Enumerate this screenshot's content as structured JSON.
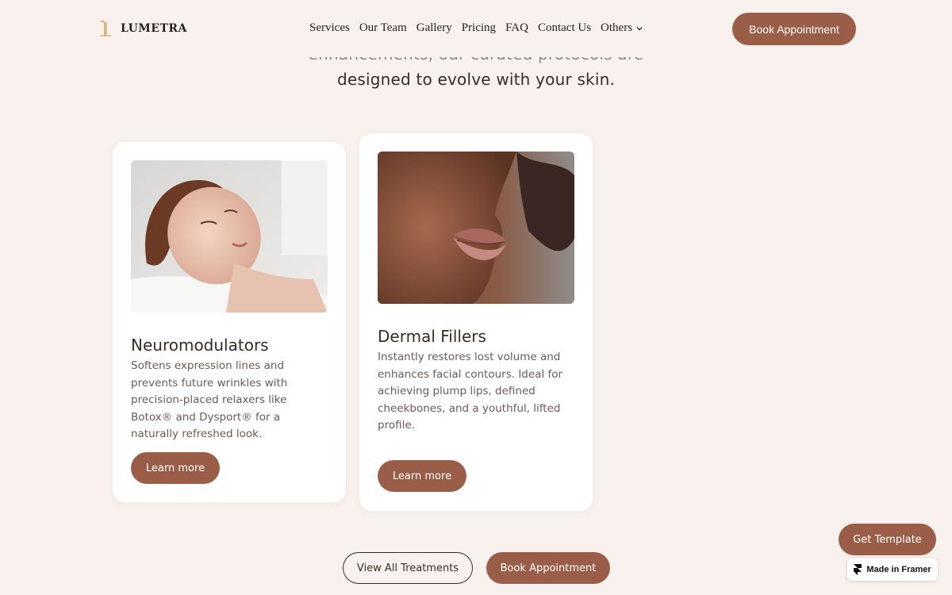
{
  "brand": {
    "name": "LUMETRA",
    "accent": "#9a5e48",
    "logo_color": "#d9b277"
  },
  "nav": {
    "items": [
      "Services",
      "Our Team",
      "Gallery",
      "Pricing",
      "FAQ",
      "Contact Us"
    ],
    "others_label": "Others"
  },
  "header": {
    "book_label": "Book Appointment"
  },
  "intro": {
    "line1": "enhancements, our curated protocols are",
    "line2": "designed to evolve with your skin."
  },
  "cards": [
    {
      "title": "Neuromodulators",
      "description": "Softens expression lines and prevents future wrinkles with precision-placed relaxers like Botox® and Dysport® for a naturally refreshed look.",
      "button": "Learn more",
      "image_icon": "woman-face-photo"
    },
    {
      "title": "Dermal Fillers",
      "description": "Instantly restores lost volume and enhances facial contours. Ideal for achieving plump lips, defined cheekbones, and a youthful, lifted profile.",
      "button": "Learn more",
      "image_icon": "lips-closeup-photo"
    }
  ],
  "cta": {
    "view_all": "View All Treatments",
    "book": "Book Appointment"
  },
  "floating": {
    "get_template": "Get Template",
    "made_in": "Made in Framer"
  }
}
